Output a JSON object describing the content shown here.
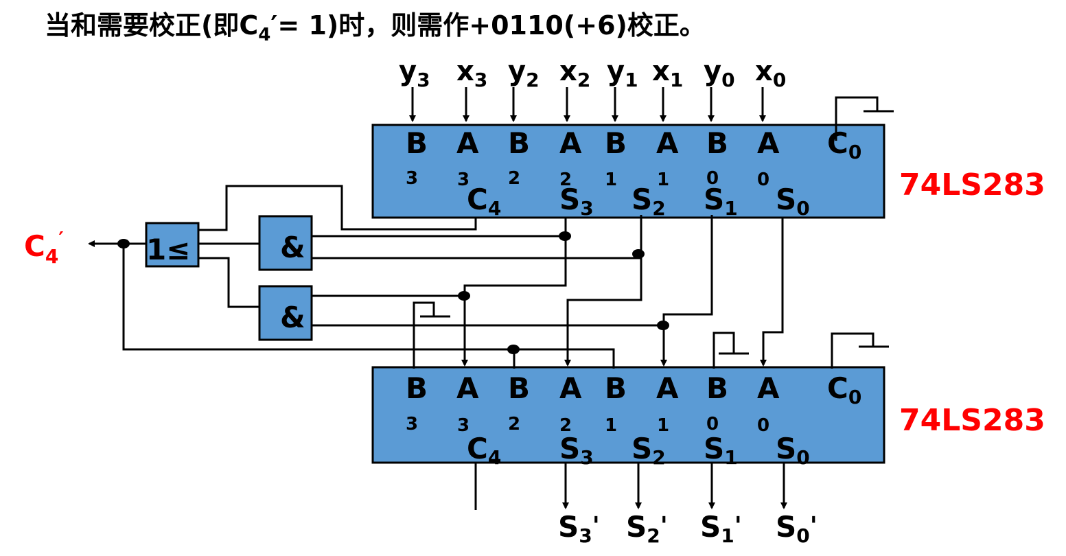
{
  "title": {
    "prefix": "当和需要校正(即C",
    "sub": "4",
    "suffix": "′= 1)时，则需作+0110(+6)校正。"
  },
  "top_inputs": [
    {
      "base": "y",
      "sub": "3"
    },
    {
      "base": "x",
      "sub": "3"
    },
    {
      "base": "y",
      "sub": "2"
    },
    {
      "base": "x",
      "sub": "2"
    },
    {
      "base": "y",
      "sub": "1"
    },
    {
      "base": "x",
      "sub": "1"
    },
    {
      "base": "y",
      "sub": "0"
    },
    {
      "base": "x",
      "sub": "0"
    }
  ],
  "chip": {
    "name": "74LS283",
    "inputs": [
      {
        "base": "B",
        "sub": "3"
      },
      {
        "base": "A",
        "sub": "3"
      },
      {
        "base": "B",
        "sub": "2"
      },
      {
        "base": "A",
        "sub": "2"
      },
      {
        "base": "B",
        "sub": "1"
      },
      {
        "base": "A",
        "sub": "1"
      },
      {
        "base": "B",
        "sub": "0"
      },
      {
        "base": "A",
        "sub": "0"
      }
    ],
    "carry_in": {
      "base": "C",
      "sub": "0"
    },
    "carry_out": {
      "base": "C",
      "sub": "4"
    },
    "sums": [
      {
        "base": "S",
        "sub": "3"
      },
      {
        "base": "S",
        "sub": "2"
      },
      {
        "base": "S",
        "sub": "1"
      },
      {
        "base": "S",
        "sub": "0"
      }
    ]
  },
  "gates": {
    "or_label": "1≤",
    "and_label": "&"
  },
  "carry_output": {
    "base": "C",
    "sub": "4",
    "prime": "′"
  },
  "final_outputs": [
    {
      "base": "S",
      "sub": "3",
      "prime": "'"
    },
    {
      "base": "S",
      "sub": "2",
      "prime": "'"
    },
    {
      "base": "S",
      "sub": "1",
      "prime": "'"
    },
    {
      "base": "S",
      "sub": "0",
      "prime": "'"
    }
  ],
  "colors": {
    "chip_fill": "#5b9bd5",
    "accent_red": "#ff0000",
    "wire": "#000000"
  }
}
